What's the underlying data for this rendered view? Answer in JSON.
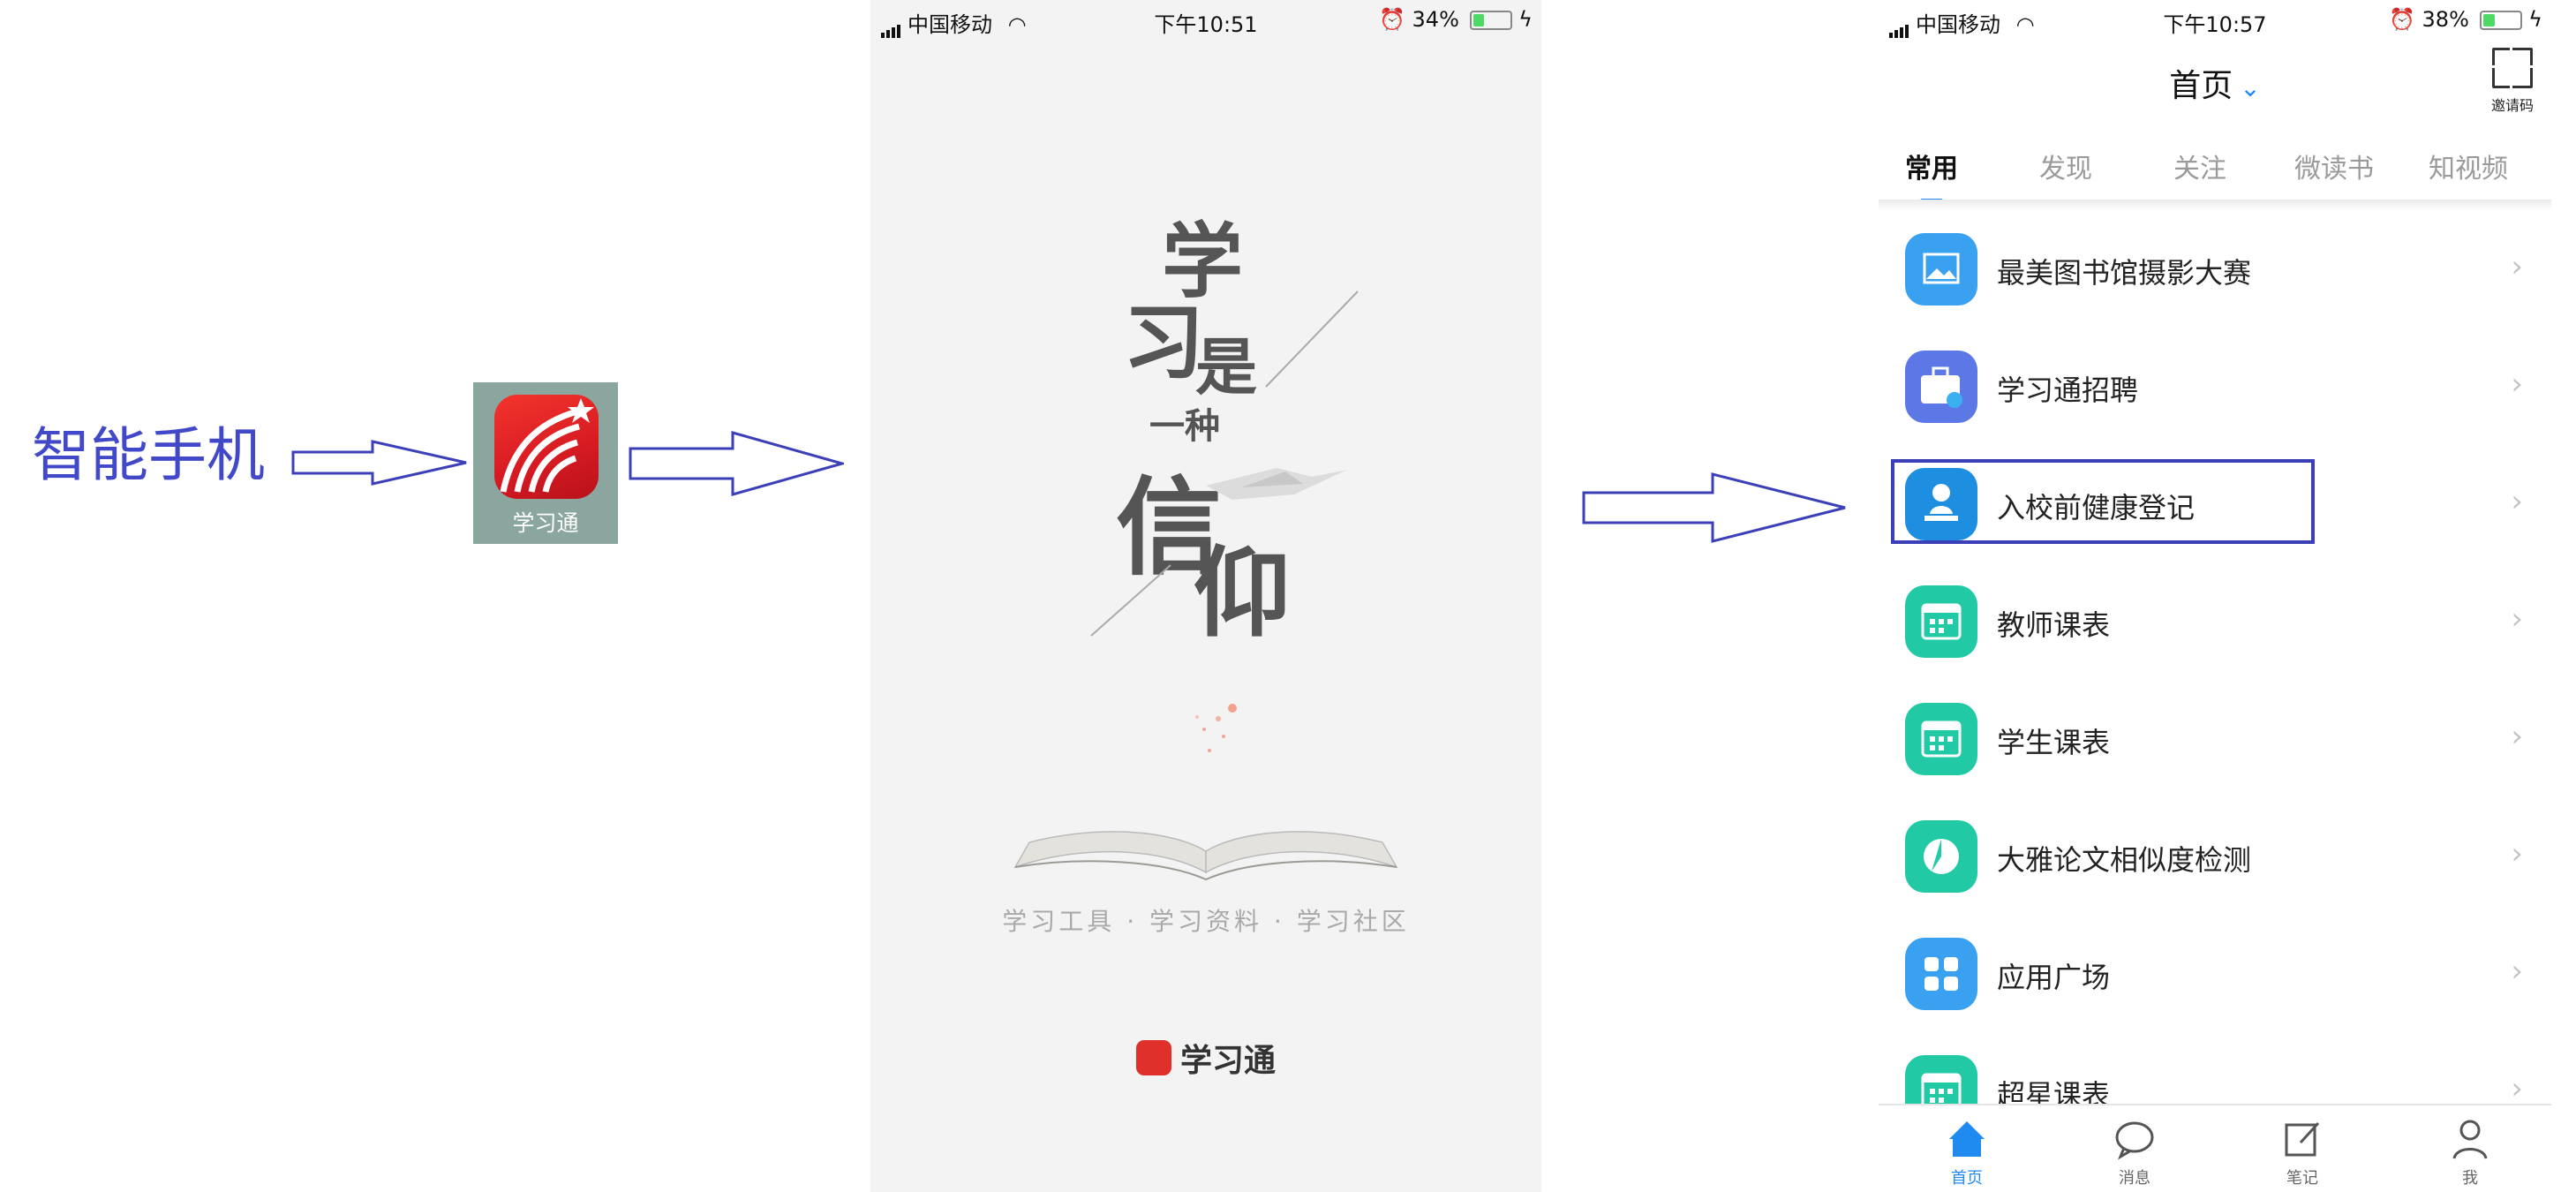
{
  "left": {
    "phone_label": "智能手机",
    "app_icon_name": "学习通"
  },
  "splash": {
    "status": {
      "carrier": "中国移动",
      "time": "下午10:51",
      "battery": "34%",
      "battery_level": 0.34
    },
    "poem": {
      "c1": "学",
      "c2": "习",
      "c3": "是",
      "c4": "一种",
      "c5": "信",
      "c6": "仰"
    },
    "tagline": "学习工具 · 学习资料 · 学习社区",
    "brand": "学习通"
  },
  "home": {
    "status": {
      "carrier": "中国移动",
      "time": "下午10:57",
      "battery": "38%",
      "battery_level": 0.38
    },
    "title": "首页",
    "invite_label": "邀请码",
    "tabs": [
      "常用",
      "发现",
      "关注",
      "微读书",
      "知视频"
    ],
    "items": [
      {
        "label": "最美图书馆摄影大赛",
        "icon": "photo-icon",
        "color": "#3aa0f0"
      },
      {
        "label": "学习通招聘",
        "icon": "briefcase-icon",
        "color": "#5b78e6"
      },
      {
        "label": "入校前健康登记",
        "icon": "person-stamp-icon",
        "color": "#1e8fe0"
      },
      {
        "label": "教师课表",
        "icon": "calendar-icon",
        "color": "#22c9a5"
      },
      {
        "label": "学生课表",
        "icon": "calendar-icon",
        "color": "#22c9a5"
      },
      {
        "label": "大雅论文相似度检测",
        "icon": "pie-icon",
        "color": "#22c9a5"
      },
      {
        "label": "应用广场",
        "icon": "grid-icon",
        "color": "#3aa0f0"
      },
      {
        "label": "超星课表",
        "icon": "calendar-icon",
        "color": "#22c9a5"
      }
    ],
    "bottom_nav": [
      "首页",
      "消息",
      "笔记",
      "我"
    ]
  },
  "colors": {
    "arrow": "#3b40b8",
    "accent": "#1f8bf0"
  }
}
